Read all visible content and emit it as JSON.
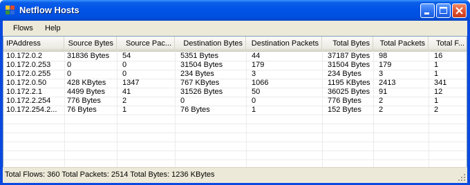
{
  "window": {
    "title": "Netflow Hosts"
  },
  "menu": [
    "Flows",
    "Help"
  ],
  "columns": [
    "IPAddress",
    "Source Bytes",
    "Source Pac...",
    "Destination Bytes",
    "Destination Packets",
    "Total Bytes",
    "Total Packets",
    "Total F..."
  ],
  "rows": [
    [
      "10.172.0.2",
      "31836 Bytes",
      "54",
      "5351 Bytes",
      "44",
      "37187 Bytes",
      "98",
      "16"
    ],
    [
      "10.172.0.253",
      "0",
      "0",
      "31504 Bytes",
      "179",
      "31504 Bytes",
      "179",
      "1"
    ],
    [
      "10.172.0.255",
      "0",
      "0",
      "234 Bytes",
      "3",
      "234 Bytes",
      "3",
      "1"
    ],
    [
      "10.172.0.50",
      "428 KBytes",
      "1347",
      "767 KBytes",
      "1066",
      "1195 KBytes",
      "2413",
      "341"
    ],
    [
      "10.172.2.1",
      "4499 Bytes",
      "41",
      "31526 Bytes",
      "50",
      "36025 Bytes",
      "91",
      "12"
    ],
    [
      "10.172.2.254",
      "776 Bytes",
      "2",
      "0",
      "0",
      "776 Bytes",
      "2",
      "1"
    ],
    [
      "10.172.254.2...",
      "76 Bytes",
      "1",
      "76 Bytes",
      "1",
      "152 Bytes",
      "2",
      "2"
    ]
  ],
  "status": "Total Flows: 360 Total Packets: 2514 Total Bytes: 1236 KBytes",
  "icons": {
    "app": "app-grid-icon",
    "minimize": "minimize-icon",
    "maximize": "maximize-icon",
    "close": "close-icon",
    "scroll_left": "arrow-left-icon",
    "scroll_right": "arrow-right-icon",
    "resize": "size-grip-icon"
  },
  "colors": {
    "titlebar": "#0053e6",
    "close_button": "#e0502e",
    "face": "#ece9d8"
  }
}
